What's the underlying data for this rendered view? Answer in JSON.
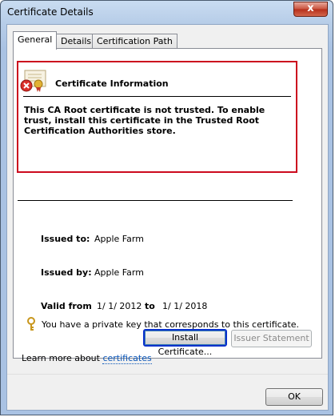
{
  "window": {
    "title": "Certificate Details",
    "close_label": "x"
  },
  "tabs": [
    {
      "label": "General",
      "active": true
    },
    {
      "label": "Details",
      "active": false
    },
    {
      "label": "Certification Path",
      "active": false
    }
  ],
  "info": {
    "title": "Certificate Information",
    "message": "This CA Root certificate is not trusted. To enable trust, install this certificate in the Trusted Root Certification Authorities store."
  },
  "fields": {
    "issued_to_label": "Issued to:",
    "issued_to_value": "Apple Farm",
    "issued_by_label": "Issued by:",
    "issued_by_value": "Apple Farm",
    "valid_from_label": "Valid from",
    "valid_from_value": "1/ 1/ 2012",
    "valid_to_label": "to",
    "valid_to_value": "1/ 1/ 2018"
  },
  "key_note": "You have a private key that corresponds to this certificate.",
  "buttons": {
    "install": "Install Certificate...",
    "issuer_statement": "Issuer Statement",
    "ok": "OK"
  },
  "learn": {
    "prefix": "Learn more about ",
    "link": "certificates"
  },
  "colors": {
    "alert_border": "#cc0a1e",
    "default_button_border": "#0a31cc",
    "link": "#0b56b8"
  }
}
